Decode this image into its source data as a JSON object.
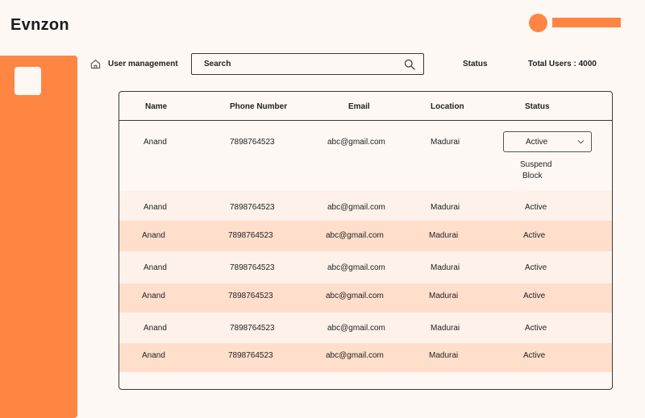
{
  "app": {
    "logo": "Evnzon"
  },
  "header": {
    "page_title": "User management",
    "status_filter": "Status",
    "total_users": "Total Users : 4000"
  },
  "search": {
    "label": "Search"
  },
  "table": {
    "columns": [
      "Name",
      "Phone Number",
      "Email",
      "Location",
      "Status"
    ],
    "rows": [
      {
        "name": "Anand",
        "phone": "7898764523",
        "email": "abc@gmail.com",
        "location": "Madurai",
        "status": "Active"
      },
      {
        "name": "Anand",
        "phone": "7898764523",
        "email": "abc@gmail.com",
        "location": "Madurai",
        "status": "Active"
      },
      {
        "name": "Anand",
        "phone": "7898764523",
        "email": "abc@gmail.com",
        "location": "Madurai",
        "status": "Active"
      },
      {
        "name": "Anand",
        "phone": "7898764523",
        "email": "abc@gmail.com",
        "location": "Madurai",
        "status": "Active"
      },
      {
        "name": "Anand",
        "phone": "7898764523",
        "email": "abc@gmail.com",
        "location": "Madurai",
        "status": "Active"
      },
      {
        "name": "Anand",
        "phone": "7898764523",
        "email": "abc@gmail.com",
        "location": "Madurai",
        "status": "Active"
      },
      {
        "name": "Anand",
        "phone": "7898764523",
        "email": "abc@gmail.com",
        "location": "Madurai",
        "status": "Active"
      }
    ],
    "status_dropdown": {
      "selected": "Active",
      "options": [
        "Suspend",
        "Block"
      ]
    }
  },
  "colors": {
    "accent": "#ff8543",
    "row_light": "#fdf1ea",
    "row_dark": "#ffdfcb",
    "background": "#fdf8f4"
  },
  "icons": {
    "home": "home-icon",
    "search": "search-icon",
    "chevron": "chevron-down-icon"
  }
}
